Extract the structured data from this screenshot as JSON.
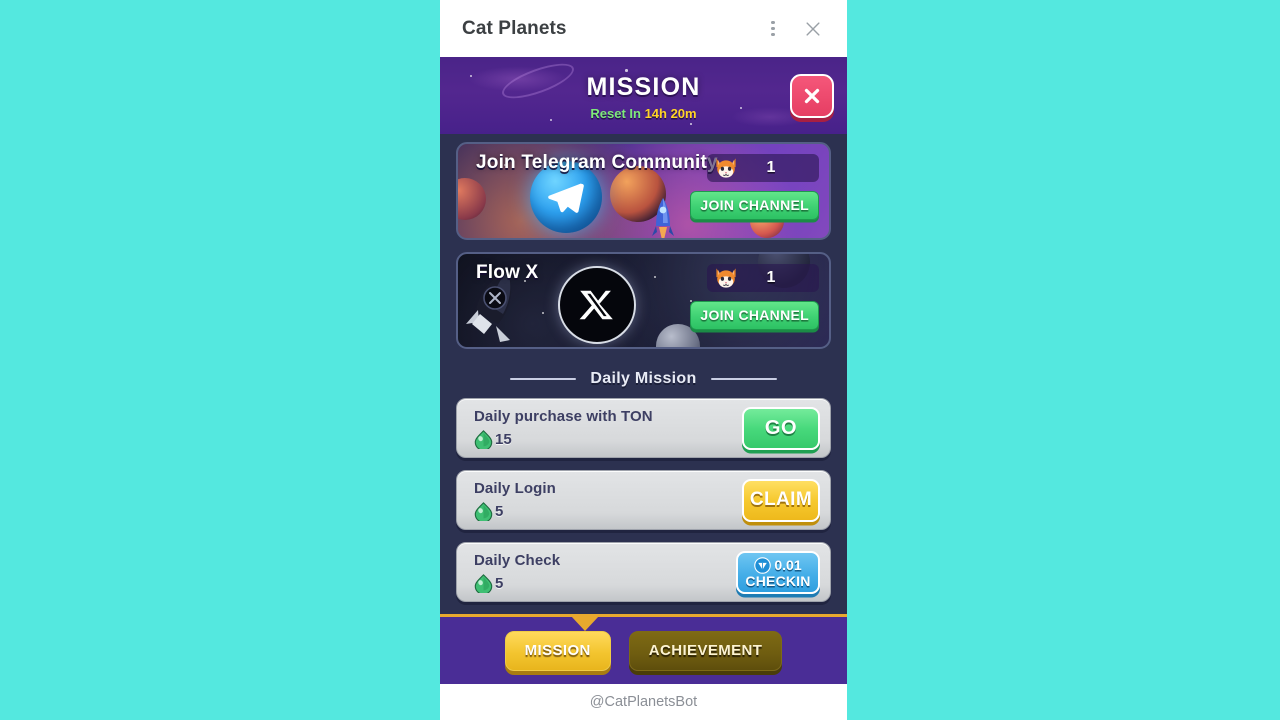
{
  "browser": {
    "title": "Cat Planets",
    "menu_icon": "three-dot-menu-icon",
    "close_icon": "close-icon"
  },
  "header": {
    "title": "MISSION",
    "reset_prefix": "Reset In ",
    "reset_time": "14h 20m",
    "close_icon": "close-icon",
    "bg_color": "#4a2488",
    "accent_color": "#ffd426"
  },
  "social_missions": [
    {
      "title": "Join Telegram Community",
      "reward_icon": "cat-face-icon",
      "reward_amount": "1",
      "button_label": "JOIN CHANNEL",
      "logo_icon": "telegram-icon"
    },
    {
      "title": "Flow X",
      "reward_icon": "cat-face-icon",
      "reward_amount": "1",
      "button_label": "JOIN CHANNEL",
      "logo_icon": "x-twitter-icon"
    }
  ],
  "daily_section": {
    "label": "Daily Mission"
  },
  "daily_missions": [
    {
      "name": "Daily purchase with TON",
      "reward_icon": "gem-icon",
      "reward_amount": "15",
      "action": "GO",
      "action_type": "go"
    },
    {
      "name": "Daily Login",
      "reward_icon": "gem-icon",
      "reward_amount": "5",
      "action": "CLAIM",
      "action_type": "claim"
    },
    {
      "name": "Daily Check",
      "reward_icon": "gem-icon",
      "reward_amount": "5",
      "action": "CHECKIN",
      "action_type": "checkin",
      "action_value": "0.01",
      "action_value_icon": "ton-coin-icon"
    }
  ],
  "tabs": [
    {
      "label": "MISSION",
      "active": true
    },
    {
      "label": "ACHIEVEMENT",
      "active": false
    }
  ],
  "footer": {
    "handle": "@CatPlanetsBot"
  },
  "colors": {
    "page_background": "#54e8df",
    "panel_background": "#2c3150",
    "header_purple": "#4a2488",
    "tabbar_purple": "#4a2d96",
    "gold": "#e8a92e",
    "green_button": "#3ed173",
    "blue_button": "#45aee8",
    "red_close": "#e63e63"
  }
}
